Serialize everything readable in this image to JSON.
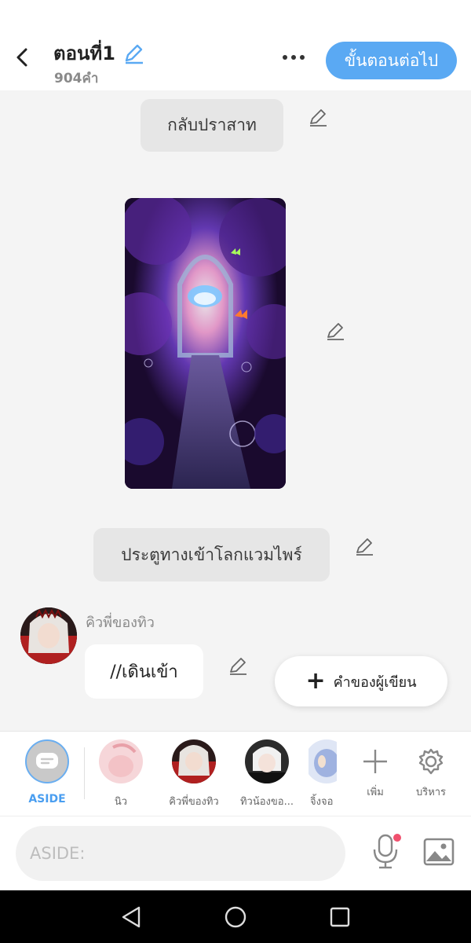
{
  "header": {
    "title": "ตอนที่1",
    "word_count": "904คำ",
    "next_label": "ขั้นตอนต่อไป"
  },
  "chat": {
    "scene_label": "กลับปราสาท",
    "image_alt": "fantasy portal gate with purple flowers and butterflies",
    "caption_label": "ประตูทางเข้าโลกแวมไพร์",
    "message": {
      "character": "คิวพี่ของทิว",
      "text": "//เดินเข้า"
    },
    "author_button_label": "คำของผู้เขียน"
  },
  "character_bar": {
    "aside_label": "ASIDE",
    "characters": [
      {
        "name": "นิว"
      },
      {
        "name": "คิวพี่ของทิว"
      },
      {
        "name": "ทิวน้องขอ..."
      },
      {
        "name": "จิ้งจอ"
      }
    ],
    "add_label": "เพิ่ม",
    "manage_label": "บริหาร"
  },
  "input": {
    "placeholder": "ASIDE:"
  },
  "colors": {
    "accent": "#5aa9f3",
    "aside_accent": "#4a9ef0",
    "mic_dot": "#f0506e"
  },
  "icons": {
    "back": "chevron-left-icon",
    "edit": "pencil-icon",
    "more": "more-horizontal-icon",
    "add": "plus-icon",
    "manage": "gear-icon",
    "mic": "mic-icon",
    "image": "image-icon"
  }
}
